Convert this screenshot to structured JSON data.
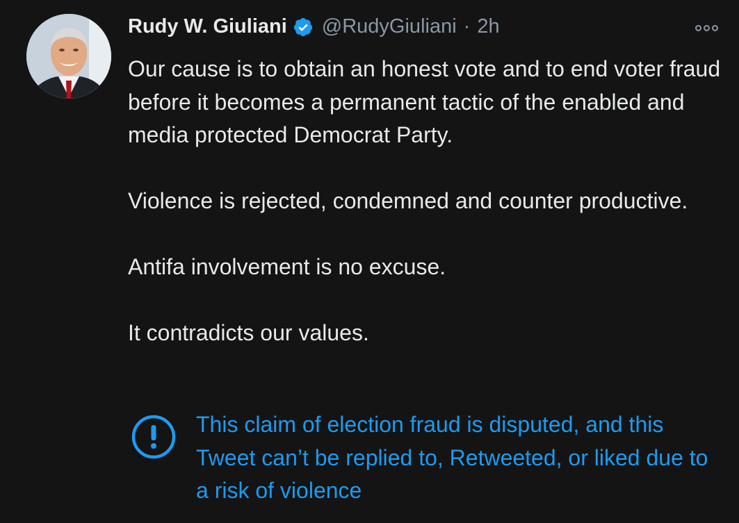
{
  "tweet": {
    "author_name": "Rudy W. Giuliani",
    "handle": "@RudyGiuliani",
    "separator": "·",
    "time": "2h",
    "paragraphs": [
      "Our cause is to obtain an honest vote and to end voter fraud before it becomes a permanent tactic of the enabled and media protected Democrat Party.",
      "Violence is rejected, condemned and counter productive.",
      "Antifa involvement is no excuse.",
      "It contradicts our values."
    ],
    "notice": "This claim of election fraud is disputed, and this Tweet can’t be replied to, Retweeted, or liked due to a risk of violence"
  },
  "icons": {
    "verified": "verified-badge-icon",
    "more": "more-options-icon",
    "notice": "exclamation-circle-icon"
  },
  "colors": {
    "background": "#141414",
    "text": "#e7e9ea",
    "secondary": "#8b98a5",
    "accent": "#1d9bf0"
  }
}
